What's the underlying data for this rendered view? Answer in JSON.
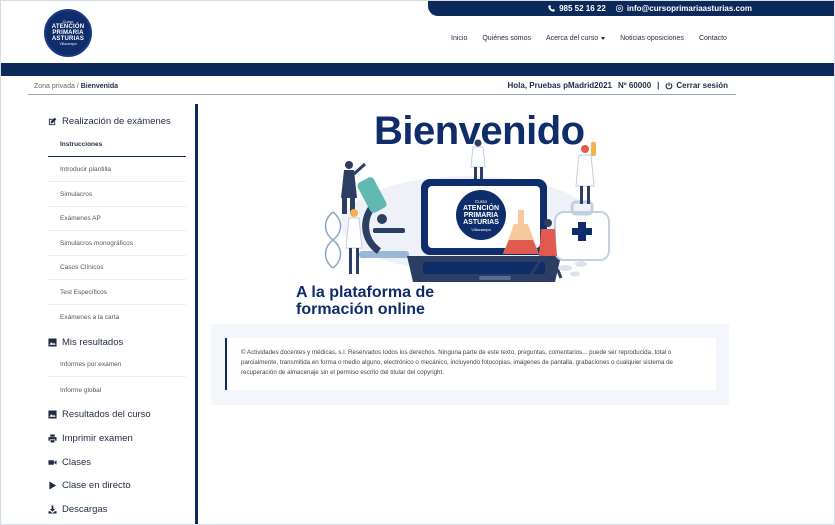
{
  "topbar": {
    "phone": "985 52 16 22",
    "email": "info@cursoprimariaasturias.com"
  },
  "logo": {
    "line1": "Curso",
    "line2": "ATENCIÓN",
    "line3": "PRIMARIA",
    "line4": "ASTURIAS",
    "line5": "Villacampa"
  },
  "nav": {
    "items": [
      "Inicio",
      "Quiénes somos",
      "Acerca del curso",
      "Noticias oposiciones",
      "Contacto"
    ]
  },
  "breadcrumb": {
    "parent": "Zona privada",
    "separator": " / ",
    "current": "Bienvenida"
  },
  "user": {
    "greeting": "Hola, Pruebas pMadrid2021",
    "number_label": "Nº 60000",
    "separator": "|",
    "logout": "Cerrar sesión"
  },
  "sidebar": {
    "exams_title": "Realización de exámenes",
    "exam_items": [
      "Instrucciones",
      "Introducir plantilla",
      "Simulacros",
      "Exámenes AP",
      "Simulacros monográficos",
      "Casos Clínicos",
      "Test Específicos",
      "Exámenes a la carta"
    ],
    "results_title": "Mis resultados",
    "results_items": [
      "Informes por examen",
      "Informe global"
    ],
    "course_results": "Resultados del curso",
    "print_exam": "Imprimir examen",
    "classes": "Clases",
    "live_class": "Clase en directo",
    "downloads": "Descargas"
  },
  "hero": {
    "title": "Bienvenido",
    "subtitle_line1": "A la plataforma de",
    "subtitle_line2": "formación online",
    "screen_logo": {
      "line1": "Curso",
      "line2": "ATENCIÓN",
      "line3": "PRIMARIA",
      "line4": "ASTURIAS",
      "line5": "Villacampa"
    }
  },
  "copyright": {
    "text": "© Actividades docentes y médicas, s.l. Reservados todos los derechos. Ninguna parte de este texto, preguntas, comentarios... puede ser reproducida, total o parcialmente, transmitida en forma o medio alguno, electrónico o mecánico, incluyendo fotocopias, imágenes de pantalla, grabaciones o cualquier sistema de recuperación de almacenaje sin el permiso escrito del titular del copyright."
  },
  "colors": {
    "navy": "#0b2a5b",
    "brand_blue": "#0f2d6b",
    "accent_red": "#e05a4f",
    "accent_teal": "#5fb9b0"
  }
}
